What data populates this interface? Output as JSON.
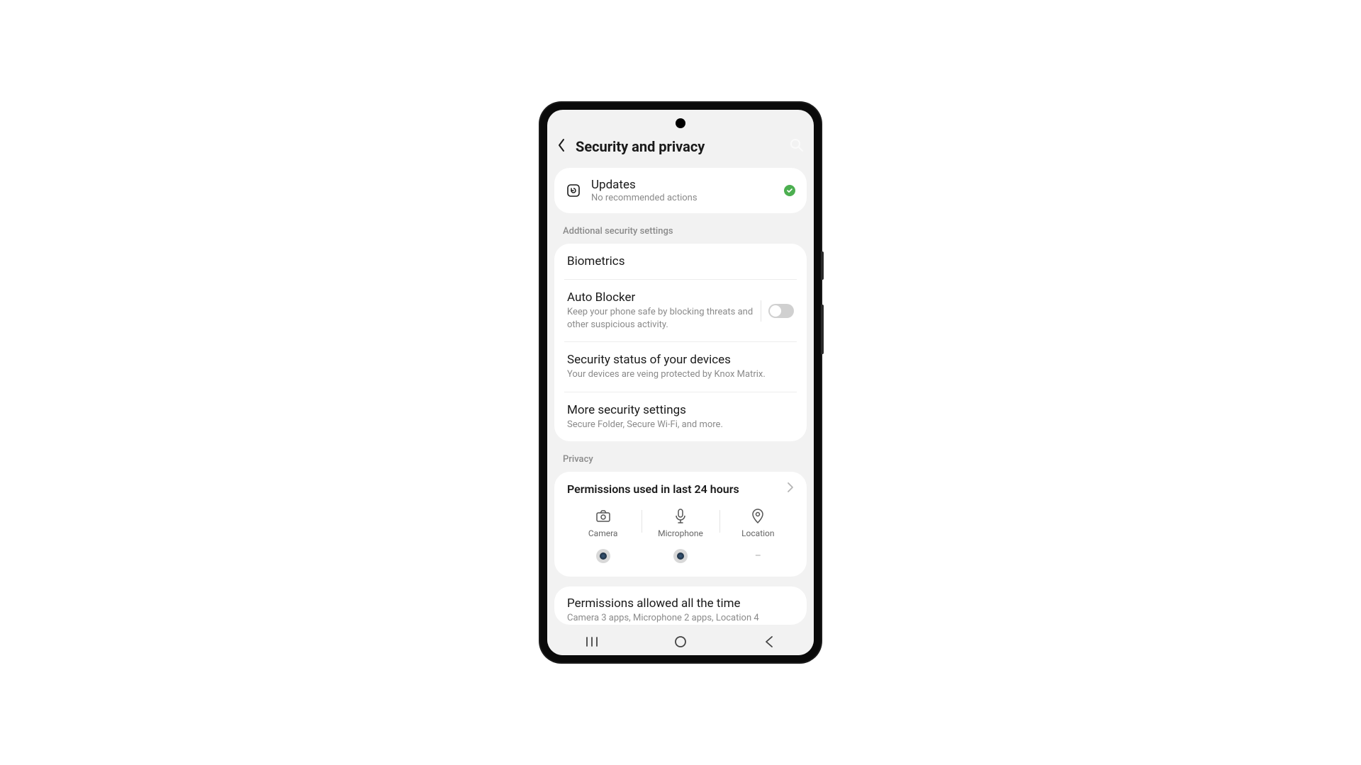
{
  "header": {
    "title": "Security and privacy"
  },
  "updates": {
    "title": "Updates",
    "subtitle": "No recommended actions"
  },
  "sections": {
    "additional": {
      "label": "Addtional security settings",
      "biometrics": {
        "title": "Biometrics"
      },
      "auto_blocker": {
        "title": "Auto Blocker",
        "subtitle": "Keep your phone safe by blocking threats and other suspicious activity.",
        "enabled": false
      },
      "security_status": {
        "title": "Security status of your devices",
        "subtitle": "Your devices are veing protected by Knox Matrix."
      },
      "more": {
        "title": "More security settings",
        "subtitle": "Secure Folder, Secure Wi-Fi, and more."
      }
    },
    "privacy": {
      "label": "Privacy",
      "permissions_24h": {
        "title": "Permissions used in last 24 hours",
        "columns": {
          "camera": "Camera",
          "microphone": "Microphone",
          "location": "Location",
          "location_value": "–"
        }
      },
      "permissions_allowed": {
        "title": "Permissions allowed all the time",
        "subtitle": "Camera 3 apps, Microphone 2 apps, Location 4"
      }
    }
  }
}
